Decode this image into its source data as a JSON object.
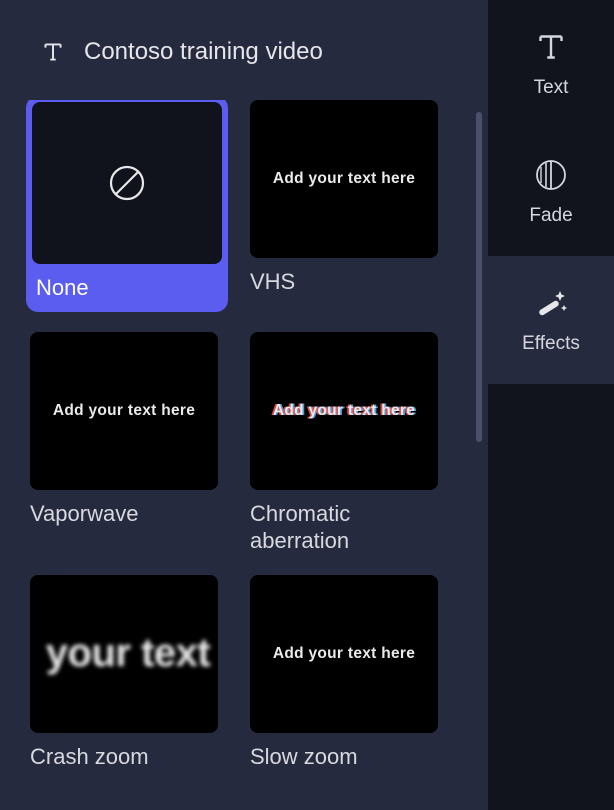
{
  "header": {
    "title": "Contoso training video"
  },
  "effects": [
    {
      "label": "None",
      "selected": true,
      "preview": "none"
    },
    {
      "label": "VHS",
      "selected": false,
      "preview": "normal",
      "preview_text": "Add your text here"
    },
    {
      "label": "Vaporwave",
      "selected": false,
      "preview": "normal",
      "preview_text": "Add your text here"
    },
    {
      "label": "Chromatic aberration",
      "selected": false,
      "preview": "chromatic",
      "preview_text": "Add your text here"
    },
    {
      "label": "Crash zoom",
      "selected": false,
      "preview": "zoomtext",
      "preview_text": "your text"
    },
    {
      "label": "Slow zoom",
      "selected": false,
      "preview": "normal",
      "preview_text": "Add your text here"
    }
  ],
  "rail": {
    "text_label": "Text",
    "fade_label": "Fade",
    "effects_label": "Effects"
  }
}
